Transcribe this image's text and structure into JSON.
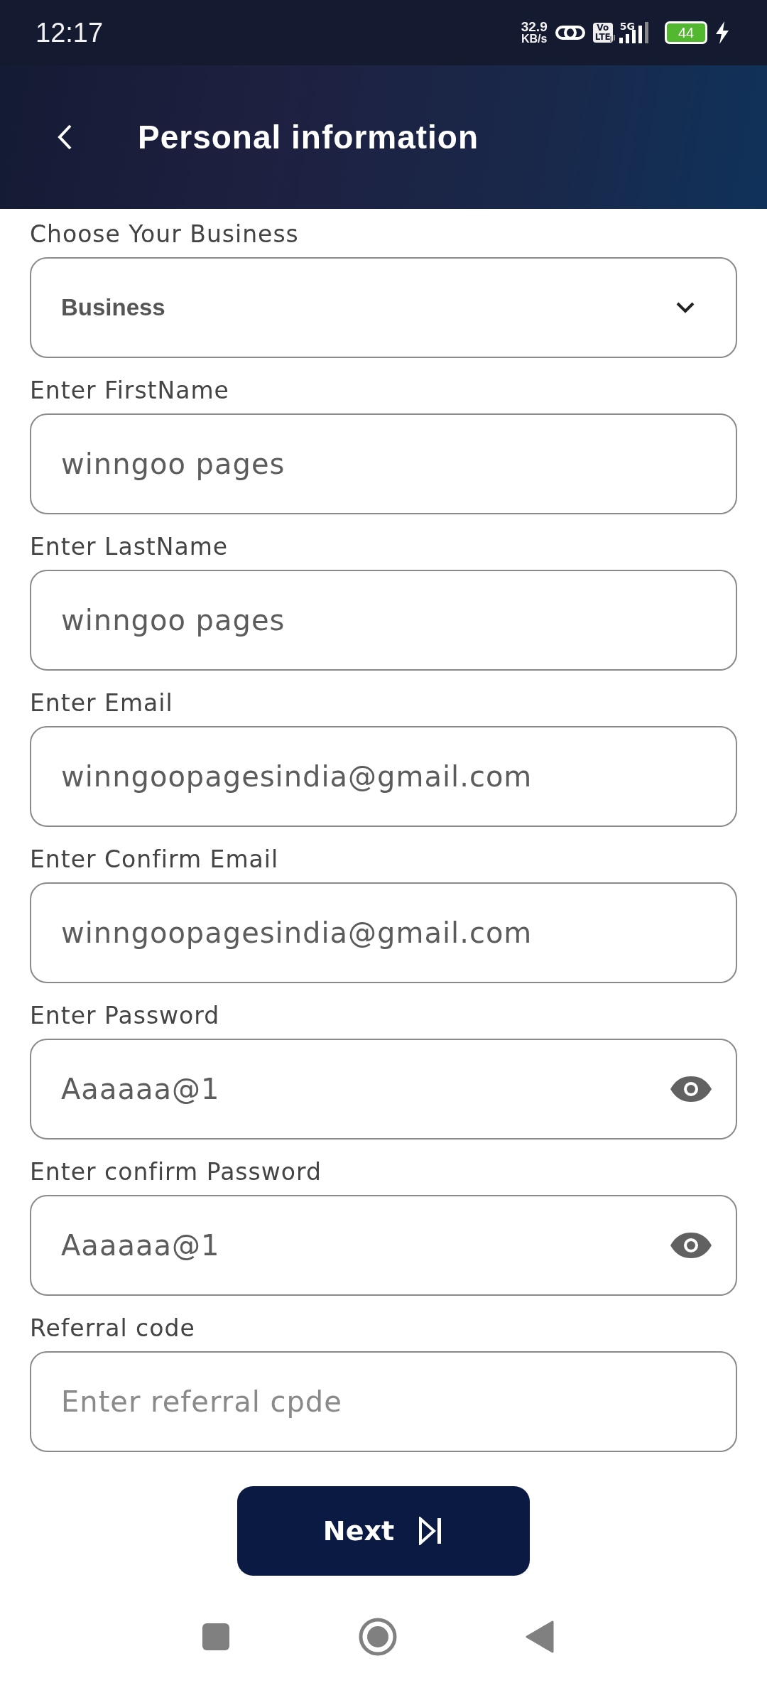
{
  "status_bar": {
    "time": "12:17",
    "speed_value": "32.9",
    "speed_unit": "KB/s",
    "volte_top": "Vo",
    "volte_bottom": "LTE",
    "network": "5G",
    "battery": "44"
  },
  "header": {
    "title": "Personal information"
  },
  "fields": [
    {
      "kind": "select",
      "label": "Choose Your Business",
      "value": "Business"
    },
    {
      "kind": "text",
      "label": "Enter FirstName",
      "value": "winngoo pages"
    },
    {
      "kind": "text",
      "label": "Enter LastName",
      "value": "winngoo pages"
    },
    {
      "kind": "text",
      "label": "Enter Email",
      "value": "winngoopagesindia@gmail.com"
    },
    {
      "kind": "text",
      "label": "Enter Confirm Email",
      "value": "winngoopagesindia@gmail.com"
    },
    {
      "kind": "password",
      "label": "Enter Password",
      "value": "Aaaaaa@1"
    },
    {
      "kind": "password",
      "label": "Enter confirm Password",
      "value": "Aaaaaa@1"
    },
    {
      "kind": "text",
      "label": "Referral code",
      "placeholder": "Enter referral cpde"
    }
  ],
  "next_button": {
    "label": "Next"
  }
}
